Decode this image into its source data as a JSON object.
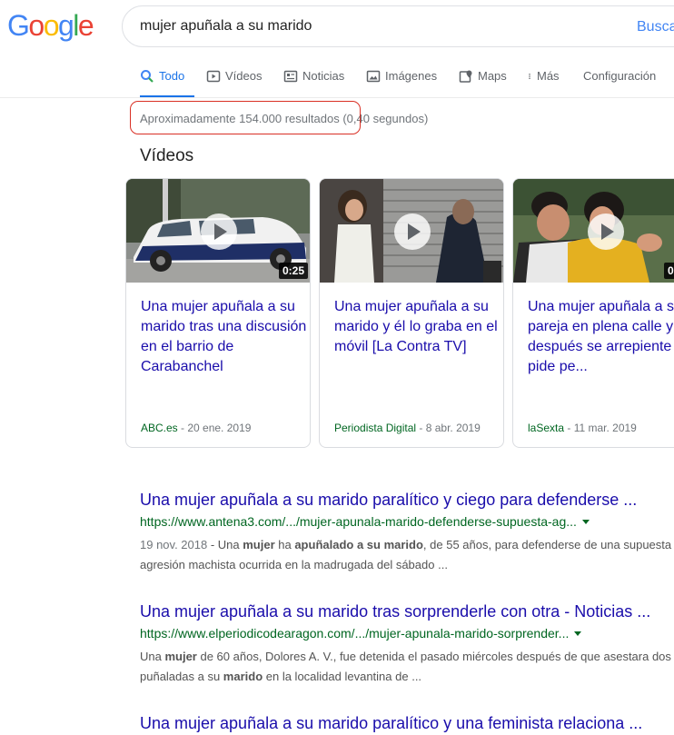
{
  "logo": {
    "letters": [
      "G",
      "o",
      "o",
      "g",
      "l",
      "e"
    ],
    "colors": [
      "#4285f4",
      "#ea4335",
      "#fbbc05",
      "#4285f4",
      "#34a853",
      "#ea4335"
    ]
  },
  "search": {
    "query": "mujer apuñala a su marido",
    "submit_label": "Buscar"
  },
  "tabs": [
    {
      "label": "Todo",
      "icon": "search-icon",
      "active": true
    },
    {
      "label": "Vídeos",
      "icon": "video-icon"
    },
    {
      "label": "Noticias",
      "icon": "news-icon"
    },
    {
      "label": "Imágenes",
      "icon": "image-icon"
    },
    {
      "label": "Maps",
      "icon": "map-pin-icon"
    },
    {
      "label": "Más",
      "icon": "more-vert-icon"
    },
    {
      "label": "Configuración"
    }
  ],
  "result_stats": {
    "count_text": "Aproximadamente 154.000 resultados",
    "time_text": "(0,40 segundos)"
  },
  "videos": {
    "title": "Vídeos",
    "items": [
      {
        "title": "Una mujer apuñala a su marido tras una discusión en el barrio de Carabanchel",
        "source": "ABC.es",
        "date": " - 20 ene. 2019",
        "duration": "0:25"
      },
      {
        "title": "Una mujer apuñala a su marido y él lo graba en el móvil [La Contra TV]",
        "source": "Periodista Digital",
        "date": " - 8 abr. 2019",
        "duration": ""
      },
      {
        "title": "Una mujer apuñala a su pareja en plena calle y después se arrepiente y le pide pe...",
        "source": "laSexta",
        "date": " - 11 mar. 2019",
        "duration": "0"
      }
    ]
  },
  "results": [
    {
      "title": "Una mujer apuñala a su marido paralítico y ciego para defenderse ...",
      "url": "https://www.antena3.com/.../mujer-apunala-marido-defenderse-supuesta-ag...",
      "date": "19 nov. 2018",
      "s1": " - Una ",
      "b1": "mujer",
      "s2": " ha ",
      "b2": "apuñalado a su marido",
      "s3": ", de 55 años, para defenderse de una supuesta agresión machista ocurrida en la madrugada del sábado ..."
    },
    {
      "title": "Una mujer apuñala a su marido tras sorprenderle con otra - Noticias ...",
      "url": "https://www.elperiodicodearagon.com/.../mujer-apunala-marido-sorprender...",
      "s1": "Una ",
      "b1": "mujer",
      "s2": " de 60 años, Dolores A. V., fue detenida el pasado miércoles después de que asestara dos puñaladas a su ",
      "b2": "marido",
      "s3": " en la localidad levantina de ..."
    },
    {
      "title": "Una mujer apuñala a su marido paralítico y una feminista relaciona ..."
    }
  ]
}
